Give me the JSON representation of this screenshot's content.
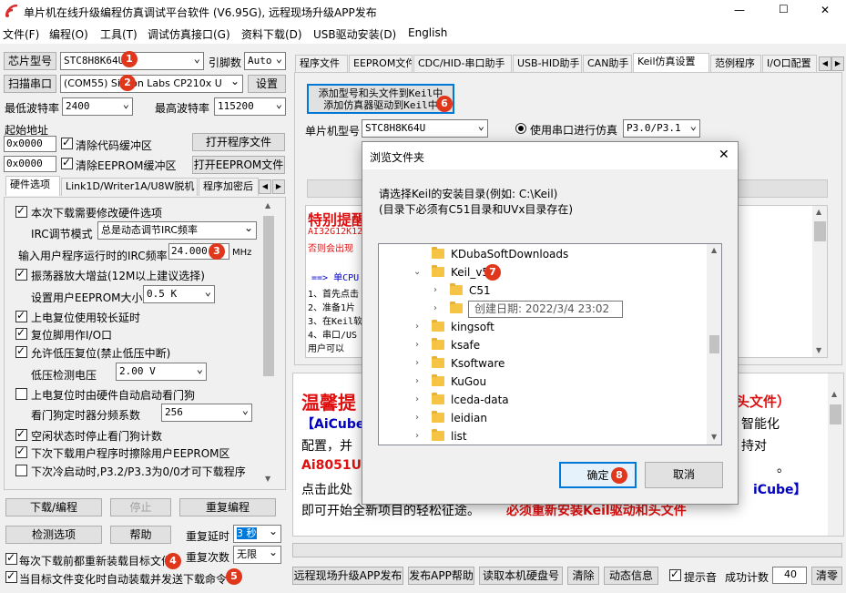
{
  "window": {
    "title": "单片机在线升级编程仿真调试平台软件 (V6.95G), 远程现场升级APP发布",
    "min": "—",
    "max": "☐",
    "close": "✕"
  },
  "menu": [
    "文件(F)",
    "编程(O)",
    "工具(T)",
    "调试仿真接口(G)",
    "资料下载(D)",
    "USB驱动安装(D)",
    "English"
  ],
  "left": {
    "chip_label": "芯片型号",
    "chip_value": "STC8H8K64U",
    "baud_label": "引脚数",
    "baud_value": "Auto",
    "scan_label": "扫描串口",
    "port_value": "(COM55) Silicon Labs CP210x U",
    "settings": "设置",
    "min_baud_label": "最低波特率",
    "min_baud": "2400",
    "max_baud_label": "最高波特率",
    "max_baud": "115200",
    "start_addr_label": "起始地址",
    "addr1": "0x0000",
    "clear_code": "清除代码缓冲区",
    "open_prog": "打开程序文件",
    "addr2": "0x0000",
    "clear_eeprom": "清除EEPROM缓冲区",
    "open_eeprom": "打开EEPROM文件",
    "tabs": [
      "硬件选项",
      "Link1D/Writer1A/U8W脱机",
      "程序加密后"
    ],
    "options": {
      "opt1": "本次下载需要修改硬件选项",
      "irc_mode_label": "IRC调节模式",
      "irc_mode": "总是动态调节IRC频率",
      "irc_freq_label": "输入用户程序运行时的IRC频率",
      "irc_freq": "24.000",
      "mhz": "MHz",
      "opt2": "振荡器放大增益(12M以上建议选择)",
      "eeprom_size_label": "设置用户EEPROM大小",
      "eeprom_size": "0.5 K",
      "opt3": "上电复位使用较长延时",
      "opt4": "复位脚用作I/O口",
      "opt5": "允许低压复位(禁止低压中断)",
      "lv_label": "低压检测电压",
      "lv_value": "2.00 V",
      "opt6": "上电复位时由硬件自动启动看门狗",
      "wdt_label": "看门狗定时器分频系数",
      "wdt_value": "256",
      "opt7": "空闲状态时停止看门狗计数",
      "opt8": "下次下载用户程序时擦除用户EEPROM区",
      "opt9": "下次冷启动时,P3.2/P3.3为0/0才可下载程序"
    },
    "download": "下载/编程",
    "stop": "停止",
    "reprogram": "重复编程",
    "check": "检测选项",
    "help": "帮助",
    "delay_label": "重复延时",
    "delay_value": "3 秒",
    "reload_each": "每次下载前都重新装载目标文件",
    "repeat_label": "重复次数",
    "repeat_value": "无限",
    "auto_reload": "当目标文件变化时自动装载并发送下载命令"
  },
  "right": {
    "tabs": [
      "程序文件",
      "EEPROM文件",
      "CDC/HID-串口助手",
      "USB-HID助手",
      "CAN助手",
      "Keil仿真设置",
      "范例程序",
      "I/O口配置"
    ],
    "add_btn_line1": "添加型号和头文件到Keil中",
    "add_btn_line2": "添加仿真器驱动到Keil中",
    "mcu_label": "单片机型号",
    "mcu_value": "STC8H8K64U",
    "use_serial": "使用串口进行仿真",
    "serial_value": "P3.0/P3.1",
    "notice_title": "特别提醒",
    "notice_lines": [
      "AI32G12K12",
      "否则会出现"
    ],
    "cpu_line": "==> 单CPU",
    "steps": [
      "1、首先点击",
      "2、准备1片",
      "3、在Keil软",
      "4、串口/US",
      "  用户可以"
    ],
    "tip_title": "温馨提",
    "tip_right": "头文件）",
    "tip_lines": [
      "【AiCube",
      "配置，并",
      "Ai8051U+",
      "点击此处",
      "即可开始全新项目的轻松征途。"
    ],
    "tip_red": "必须重新安装Keil驱动和头文件",
    "tip_r1": "智能化",
    "tip_r2": "持对",
    "tip_r3": "。",
    "tip_r4": "iCube】"
  },
  "bottom": {
    "publish": "远程现场升级APP发布",
    "publish_help": "发布APP帮助",
    "read_disk": "读取本机硬盘号",
    "clear": "清除",
    "dynamic": "动态信息",
    "beep": "提示音",
    "success_label": "成功计数",
    "success_count": "40",
    "zero": "清零"
  },
  "dialog": {
    "title": "浏览文件夹",
    "close": "✕",
    "line1": "请选择Keil的安装目录(例如: C:\\Keil)",
    "line2": "(目录下必须有C51目录和UVx目录存在)",
    "tree": [
      "KDubaSoftDownloads",
      "Keil_v5",
      "C51",
      "",
      "kingsoft",
      "ksafe",
      "Ksoftware",
      "KuGou",
      "lceda-data",
      "leidian",
      "list"
    ],
    "tooltip": "创建日期: 2022/3/4 23:02",
    "ok": "确定",
    "cancel": "取消"
  },
  "badges": [
    "1",
    "2",
    "3",
    "4",
    "5",
    "6",
    "7",
    "8"
  ]
}
